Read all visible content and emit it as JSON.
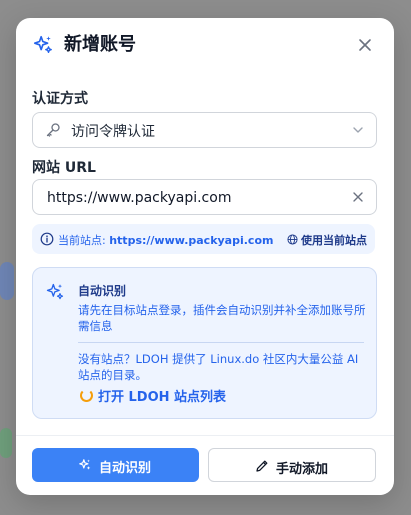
{
  "dialog": {
    "title": "新增账号",
    "close_icon": "close-icon",
    "accent_color": "#3b82f6"
  },
  "auth_method": {
    "label": "认证方式",
    "selected_value": "访问令牌认证",
    "icon": "key-icon"
  },
  "site_url": {
    "label": "网站 URL",
    "value": "https://www.packyapi.com"
  },
  "current_site": {
    "label": "当前站点:",
    "value": "https://www.packyapi.com",
    "use_button": "使用当前站点"
  },
  "auto_detect_card": {
    "title": "自动识别",
    "description": "请先在目标站点登录，插件会自动识别并补全添加账号所需信息",
    "note": "没有站点？LDOH 提供了 Linux.do 社区内大量公益 AI 站点的目录。",
    "open_link": "打开 LDOH 站点列表"
  },
  "footer": {
    "primary_button": "自动识别",
    "secondary_button": "手动添加"
  }
}
